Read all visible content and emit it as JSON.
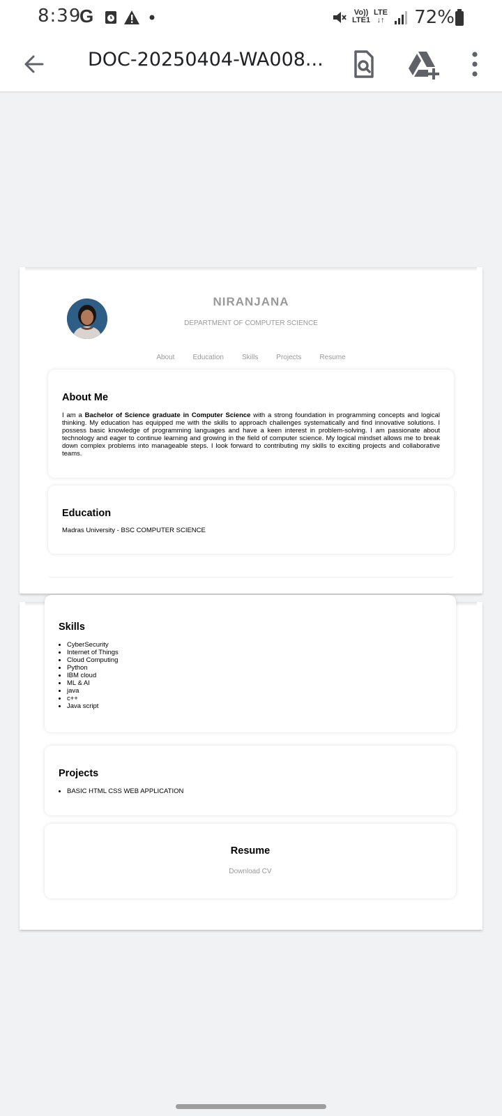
{
  "status_bar": {
    "time": "8:39",
    "g_icon": "G",
    "battery": "72%",
    "volte_top": "Vo))",
    "volte_bottom": "LTE1",
    "lte_top": "LTE",
    "lte_bottom": "↓↑",
    "icons": [
      "google-icon",
      "calendar-icon",
      "alert-icon",
      "dot-icon",
      "mute-icon",
      "volte-icon",
      "lte-icon",
      "signal-icon",
      "battery-icon"
    ]
  },
  "toolbar": {
    "title": "DOC-20250404-WA008...",
    "icons": [
      "back-arrow-icon",
      "search-document-icon",
      "drive-add-icon",
      "more-vert-icon"
    ]
  },
  "document": {
    "name": "NIRANJANA",
    "department": "DEPARTMENT OF COMPUTER SCIENCE",
    "nav": [
      "About",
      "Education",
      "Skills",
      "Projects",
      "Resume"
    ],
    "about": {
      "heading": "About Me",
      "intro": "I am a ",
      "bold": "Bachelor of Science graduate in Computer Science",
      "rest": " with a strong foundation in programming concepts and logical thinking. My education has equipped me with the skills to approach challenges systematically and find innovative solutions. I possess basic knowledge of programming languages and have a keen interest in problem-solving. I am passionate about technology and eager to continue learning and growing in the field of computer science. My logical mindset allows me to break down complex problems into manageable steps. I look forward to contributing my skills to exciting projects and collaborative teams."
    },
    "education": {
      "heading": "Education",
      "text": "Madras University - BSC COMPUTER SCIENCE"
    },
    "skills": {
      "heading": "Skills",
      "items": [
        "CyberSecurity",
        "Internet of Things",
        "Cloud Computing",
        "Python",
        "IBM cloud",
        "ML & AI",
        "java",
        "c++",
        "Java script"
      ]
    },
    "projects": {
      "heading": "Projects",
      "items": [
        "BASIC HTML CSS WEB APPLICATION"
      ]
    },
    "resume": {
      "heading": "Resume",
      "link": "Download CV"
    }
  },
  "colors": {
    "background": "#f1f2f4",
    "muted_text": "#999999",
    "avatar_bg": "#2e5e86"
  }
}
